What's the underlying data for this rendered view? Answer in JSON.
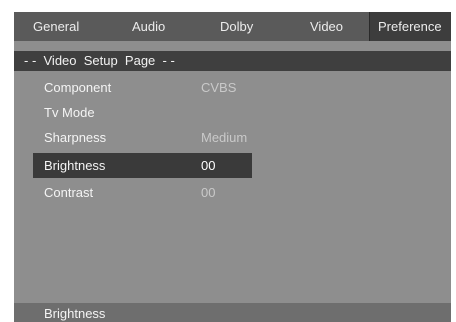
{
  "tabs": [
    {
      "label": "General"
    },
    {
      "label": "Audio"
    },
    {
      "label": "Dolby"
    },
    {
      "label": "Video"
    },
    {
      "label": "Preference"
    }
  ],
  "page_title": "- -  Video  Setup  Page  - -",
  "settings": [
    {
      "label": "Component",
      "value": "CVBS"
    },
    {
      "label": "Tv Mode",
      "value": ""
    },
    {
      "label": "Sharpness",
      "value": "Medium"
    },
    {
      "label": "Brightness",
      "value": "00"
    },
    {
      "label": "Contrast",
      "value": "00"
    }
  ],
  "status": "Brightness",
  "colors": {
    "screen_bg": "#8e8e8e",
    "tab_bar": "#5a5a5a",
    "active_tab": "#3d3d3d",
    "title_bar": "#3f3f3f",
    "selected_row": "#3a3a3a"
  }
}
